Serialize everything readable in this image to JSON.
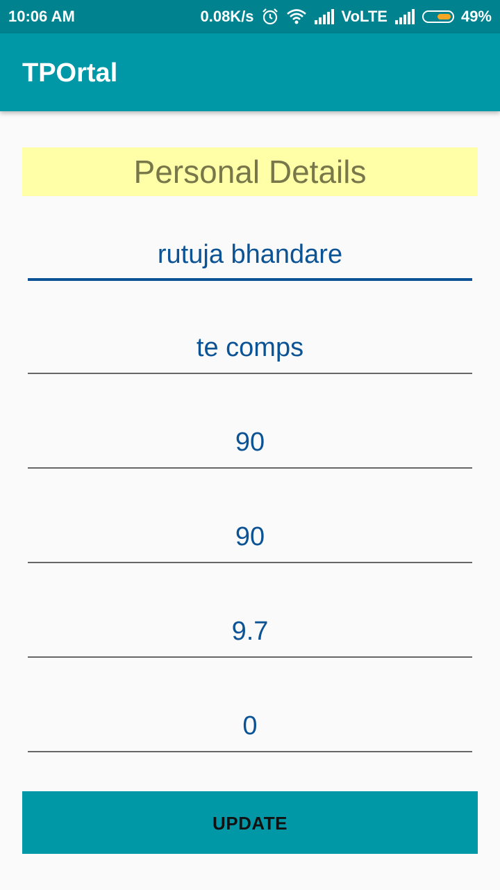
{
  "status_bar": {
    "time": "10:06 AM",
    "network_speed": "0.08K/s",
    "network_type": "VoLTE",
    "battery_percent": "49%",
    "battery_level": 0.49,
    "icons": [
      "alarm-icon",
      "wifi-icon",
      "signal-icon",
      "signal-icon",
      "battery-icon"
    ],
    "battery_color": "#f5a623"
  },
  "app_bar": {
    "title": "TPOrtal",
    "color": "#0097a7"
  },
  "form": {
    "header": "Personal Details",
    "fields": [
      {
        "value": "rutuja bhandare"
      },
      {
        "value": "te comps"
      },
      {
        "value": "90"
      },
      {
        "value": "90"
      },
      {
        "value": "9.7"
      },
      {
        "value": "0"
      }
    ],
    "submit_label": "UPDATE"
  },
  "colors": {
    "accent": "#0097a7",
    "status_bar": "#00838f",
    "header_bg": "#ffffa8",
    "text_value": "#0b5394"
  }
}
